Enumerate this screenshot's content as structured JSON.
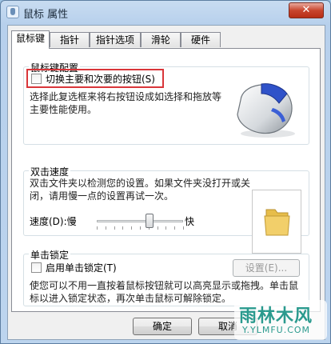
{
  "window": {
    "title": "鼠标 属性",
    "close_glyph": "✕"
  },
  "tabs": [
    {
      "label": "鼠标键"
    },
    {
      "label": "指针"
    },
    {
      "label": "指针选项"
    },
    {
      "label": "滑轮"
    },
    {
      "label": "硬件"
    }
  ],
  "button_config": {
    "group_label": "鼠标键配置",
    "swap_checkbox_label": "切换主要和次要的按钮(S)",
    "description": "选择此复选框来将右按钮设成如选择和拖放等主要性能使用。"
  },
  "double_click": {
    "group_label": "双击速度",
    "description": "双击文件夹以检测您的设置。如果文件夹没打开或关闭，请用慢一点的设置再试一次。",
    "speed_label": "速度(D):慢",
    "fast_label": "快",
    "speed_level_fraction": 0.61
  },
  "click_lock": {
    "group_label": "单击锁定",
    "enable_checkbox_label": "启用单击锁定(T)",
    "settings_button": "设置(E)...",
    "description": "使您可以不用一直按着鼠标按钮就可以高亮显示或拖拽。单击鼠标以进入锁定状态，再次单击鼠标可解除锁定。"
  },
  "footer": {
    "ok_button": "确定",
    "cancel_button": "取消"
  },
  "watermark": {
    "main": "雨林木风",
    "sub": "Y.YLMFU.COM"
  },
  "colors": {
    "highlight_box": "#d9363a",
    "folder": "#f2cf6a"
  }
}
